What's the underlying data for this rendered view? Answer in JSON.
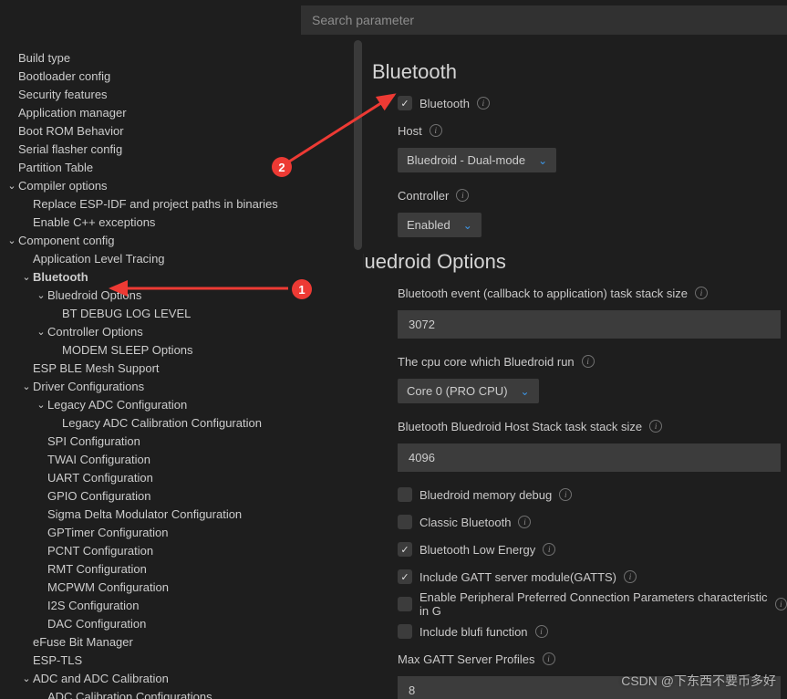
{
  "search": {
    "placeholder": "Search parameter",
    "value": ""
  },
  "sidebar": [
    {
      "lvl": 1,
      "chev": "",
      "label": "Build type"
    },
    {
      "lvl": 1,
      "chev": "",
      "label": "Bootloader config"
    },
    {
      "lvl": 1,
      "chev": "",
      "label": "Security features"
    },
    {
      "lvl": 1,
      "chev": "",
      "label": "Application manager"
    },
    {
      "lvl": 1,
      "chev": "",
      "label": "Boot ROM Behavior"
    },
    {
      "lvl": 1,
      "chev": "",
      "label": "Serial flasher config"
    },
    {
      "lvl": 1,
      "chev": "",
      "label": "Partition Table"
    },
    {
      "lvl": 1,
      "chev": "v",
      "label": "Compiler options"
    },
    {
      "lvl": 2,
      "chev": "",
      "label": "Replace ESP-IDF and project paths in binaries"
    },
    {
      "lvl": 2,
      "chev": "",
      "label": "Enable C++ exceptions"
    },
    {
      "lvl": 1,
      "chev": "v",
      "label": "Component config"
    },
    {
      "lvl": 2,
      "chev": "",
      "label": "Application Level Tracing"
    },
    {
      "lvl": 2,
      "chev": "v",
      "label": "Bluetooth",
      "bold": true,
      "id": "row-bluetooth"
    },
    {
      "lvl": 3,
      "chev": "v",
      "label": "Bluedroid Options"
    },
    {
      "lvl": 4,
      "chev": "",
      "label": "BT DEBUG LOG LEVEL"
    },
    {
      "lvl": 3,
      "chev": "v",
      "label": "Controller Options"
    },
    {
      "lvl": 4,
      "chev": "",
      "label": "MODEM SLEEP Options"
    },
    {
      "lvl": 2,
      "chev": "",
      "label": "ESP BLE Mesh Support"
    },
    {
      "lvl": 2,
      "chev": "v",
      "label": "Driver Configurations"
    },
    {
      "lvl": 3,
      "chev": "v",
      "label": "Legacy ADC Configuration"
    },
    {
      "lvl": 4,
      "chev": "",
      "label": "Legacy ADC Calibration Configuration"
    },
    {
      "lvl": 3,
      "chev": "",
      "label": "SPI Configuration"
    },
    {
      "lvl": 3,
      "chev": "",
      "label": "TWAI Configuration"
    },
    {
      "lvl": 3,
      "chev": "",
      "label": "UART Configuration"
    },
    {
      "lvl": 3,
      "chev": "",
      "label": "GPIO Configuration"
    },
    {
      "lvl": 3,
      "chev": "",
      "label": "Sigma Delta Modulator Configuration"
    },
    {
      "lvl": 3,
      "chev": "",
      "label": "GPTimer Configuration"
    },
    {
      "lvl": 3,
      "chev": "",
      "label": "PCNT Configuration"
    },
    {
      "lvl": 3,
      "chev": "",
      "label": "RMT Configuration"
    },
    {
      "lvl": 3,
      "chev": "",
      "label": "MCPWM Configuration"
    },
    {
      "lvl": 3,
      "chev": "",
      "label": "I2S Configuration"
    },
    {
      "lvl": 3,
      "chev": "",
      "label": "DAC Configuration"
    },
    {
      "lvl": 2,
      "chev": "",
      "label": "eFuse Bit Manager"
    },
    {
      "lvl": 2,
      "chev": "",
      "label": "ESP-TLS"
    },
    {
      "lvl": 2,
      "chev": "v",
      "label": "ADC and ADC Calibration"
    },
    {
      "lvl": 3,
      "chev": "",
      "label": "ADC Calibration Configurations"
    }
  ],
  "content": {
    "bluetooth": {
      "title": "Bluetooth",
      "enable": {
        "label": "Bluetooth",
        "checked": true
      },
      "host": {
        "label": "Host",
        "value": "Bluedroid - Dual-mode"
      },
      "controller": {
        "label": "Controller",
        "value": "Enabled"
      }
    },
    "bluedroid": {
      "title": "Bluedroid Options",
      "stack_cb": {
        "label": "Bluetooth event (callback to application) task stack size",
        "value": "3072"
      },
      "core": {
        "label": "The cpu core which Bluedroid run",
        "value": "Core 0 (PRO CPU)"
      },
      "host_stack": {
        "label": "Bluetooth Bluedroid Host Stack task stack size",
        "value": "4096"
      },
      "checks": [
        {
          "label": "Bluedroid memory debug",
          "checked": false
        },
        {
          "label": "Classic Bluetooth",
          "checked": false
        },
        {
          "label": "Bluetooth Low Energy",
          "checked": true
        },
        {
          "label": "Include GATT server module(GATTS)",
          "checked": true
        },
        {
          "label": "Enable Peripheral Preferred Connection Parameters characteristic in G",
          "checked": false
        },
        {
          "label": "Include blufi function",
          "checked": false
        }
      ],
      "max_profiles": {
        "label": "Max GATT Server Profiles",
        "value": "8"
      }
    }
  },
  "annotations": {
    "badge1": "1",
    "badge2": "2"
  },
  "watermark": "CSDN @下东西不要币多好"
}
